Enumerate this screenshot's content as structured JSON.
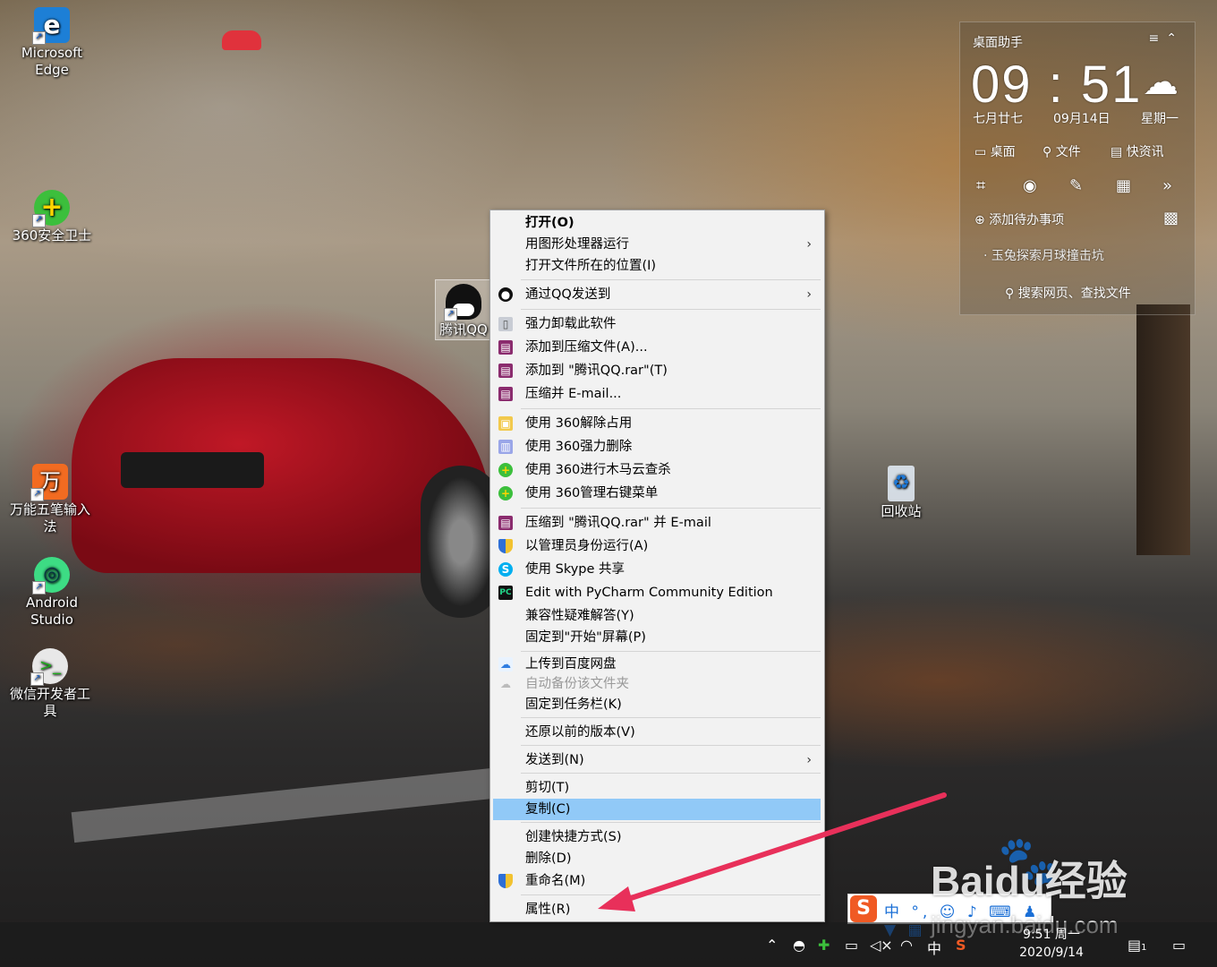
{
  "desktop": {
    "icons": [
      {
        "label": "Microsoft Edge",
        "icon": "edge-icon"
      },
      {
        "label": "360安全卫士",
        "icon": "360-icon"
      },
      {
        "label": "腾讯QQ",
        "icon": "qq-icon"
      },
      {
        "label": "万能五笔输入法",
        "icon": "wubi-icon"
      },
      {
        "label": "Android Studio",
        "icon": "android-studio-icon"
      },
      {
        "label": "微信开发者工具",
        "icon": "wechat-devtools-icon"
      },
      {
        "label": "回收站",
        "icon": "recycle-bin-icon"
      }
    ]
  },
  "widget": {
    "title": "桌面助手",
    "time": "09 : 51",
    "lunar_date": "七月廿七",
    "date": "09月14日",
    "weekday": "星期一",
    "tab_desktop": "桌面",
    "tab_files": "文件",
    "tab_news": "快资讯",
    "add_todo": "添加待办事项",
    "news_item": "玉兔探索月球撞击坑",
    "search": "搜索网页、查找文件"
  },
  "context_menu": {
    "items": [
      {
        "label": "打开(O)"
      },
      {
        "label": "用图形处理器运行"
      },
      {
        "label": "打开文件所在的位置(I)"
      },
      {
        "label": "通过QQ发送到"
      },
      {
        "label": "强力卸载此软件"
      },
      {
        "label": "添加到压缩文件(A)..."
      },
      {
        "label": "添加到 \"腾讯QQ.rar\"(T)"
      },
      {
        "label": "压缩并 E-mail..."
      },
      {
        "label": "使用 360解除占用"
      },
      {
        "label": "使用 360强力删除"
      },
      {
        "label": "使用 360进行木马云查杀"
      },
      {
        "label": "使用 360管理右键菜单"
      },
      {
        "label": "压缩到 \"腾讯QQ.rar\" 并 E-mail"
      },
      {
        "label": "以管理员身份运行(A)"
      },
      {
        "label": "使用 Skype 共享"
      },
      {
        "label": "Edit with PyCharm Community Edition"
      },
      {
        "label": "兼容性疑难解答(Y)"
      },
      {
        "label": "固定到\"开始\"屏幕(P)"
      },
      {
        "label": "上传到百度网盘"
      },
      {
        "label": "自动备份该文件夹"
      },
      {
        "label": "固定到任务栏(K)"
      },
      {
        "label": "还原以前的版本(V)"
      },
      {
        "label": "发送到(N)"
      },
      {
        "label": "剪切(T)"
      },
      {
        "label": "复制(C)"
      },
      {
        "label": "创建快捷方式(S)"
      },
      {
        "label": "删除(D)"
      },
      {
        "label": "重命名(M)"
      },
      {
        "label": "属性(R)"
      }
    ]
  },
  "taskbar": {
    "time": "9:51 周一",
    "date": "2020/9/14",
    "ime_lang": "中",
    "notification_count": "1"
  },
  "ime_bar": {
    "logo": "S",
    "mode": "中"
  },
  "watermark": {
    "brand": "Baidu经验",
    "url": "jingyan.baidu.com"
  }
}
